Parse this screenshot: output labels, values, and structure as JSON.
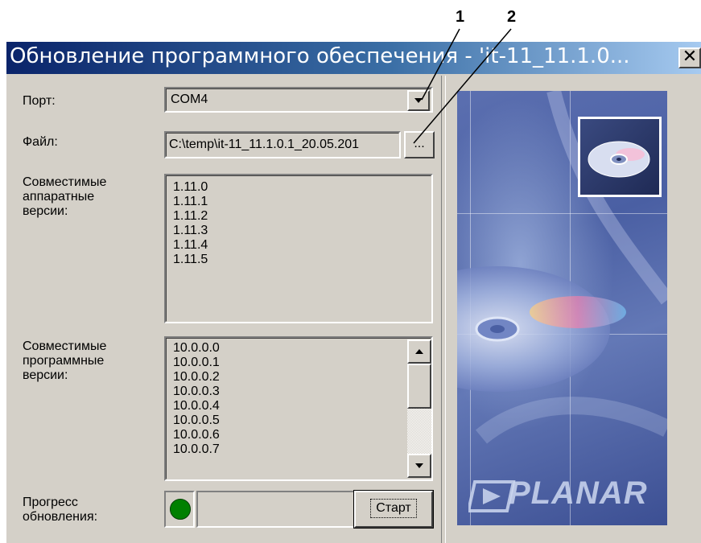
{
  "callouts": [
    "1",
    "2"
  ],
  "window": {
    "title": "Обновление программного обеспечения - 'it-11_11.1.0...",
    "close_symbol": "✕"
  },
  "port": {
    "label": "Порт:",
    "value": "COM4"
  },
  "file": {
    "label": "Файл:",
    "value": "C:\\temp\\it-11_11.1.0.1_20.05.201",
    "browse_label": "..."
  },
  "hardware": {
    "label_lines": [
      "Совместимые",
      "аппаратные",
      "версии:"
    ],
    "items": [
      "1.11.0",
      "1.11.1",
      "1.11.2",
      "1.11.3",
      "1.11.4",
      "1.11.5"
    ]
  },
  "software": {
    "label_lines": [
      "Совместимые",
      "программные",
      "версии:"
    ],
    "items": [
      "10.0.0.0",
      "10.0.0.1",
      "10.0.0.2",
      "10.0.0.3",
      "10.0.0.4",
      "10.0.0.5",
      "10.0.0.6",
      "10.0.0.7"
    ]
  },
  "progress": {
    "label_lines": [
      "Прогресс",
      "обновления:"
    ],
    "indicator_color": "#008000",
    "start_label": "Старт"
  },
  "image_panel": {
    "logo": "PLANAR"
  },
  "colors": {
    "title_gradient_start": "#0a246a",
    "title_gradient_end": "#a6caf0",
    "face": "#d4d0c8"
  }
}
